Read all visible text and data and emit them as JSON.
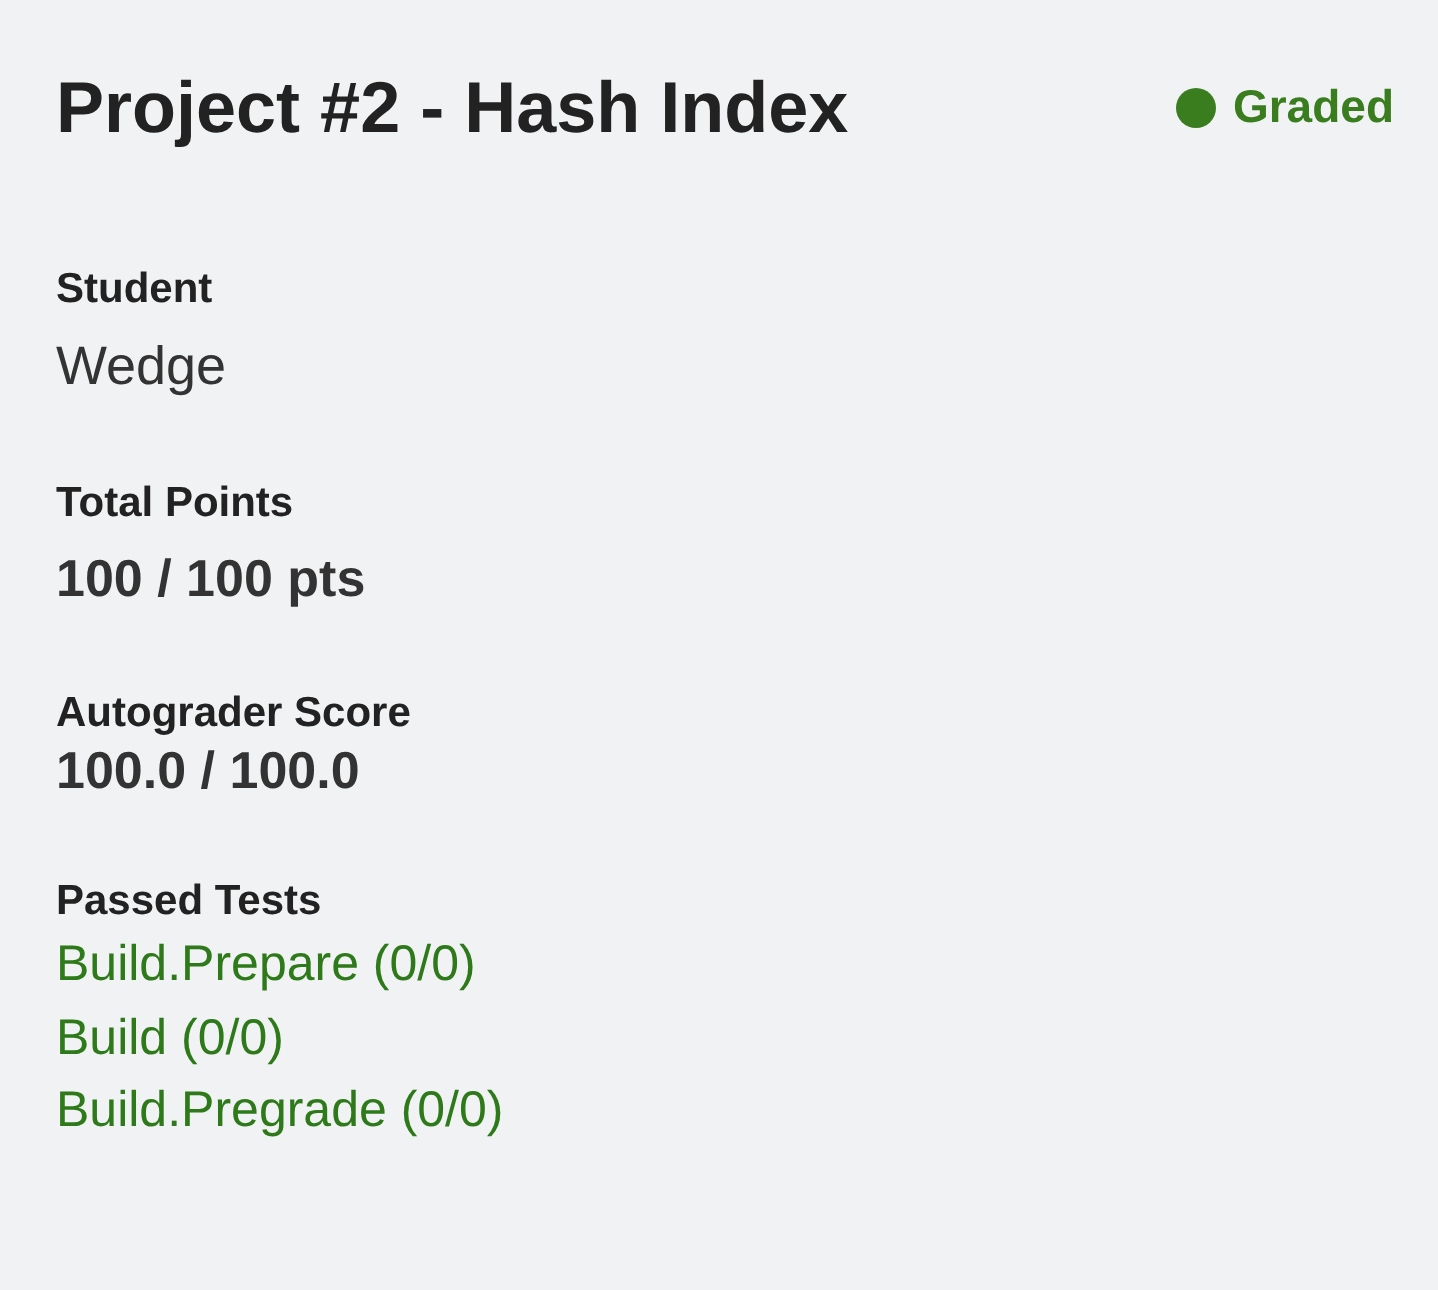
{
  "title": "Project #2 - Hash Index",
  "status": {
    "label": "Graded",
    "kind": "graded"
  },
  "sections": [
    {
      "label": "Student",
      "kind": "text",
      "value": "Wedge"
    },
    {
      "label": "Total Points",
      "kind": "points",
      "value": "100 / 100 pts"
    },
    {
      "label": "Autograder Score",
      "kind": "score",
      "value": "100.0 / 100.0"
    },
    {
      "label": "Passed Tests",
      "kind": "links",
      "items": [
        "Build.Prepare (0/0)",
        "Build (0/0)",
        "Build.Pregrade (0/0)"
      ]
    }
  ]
}
